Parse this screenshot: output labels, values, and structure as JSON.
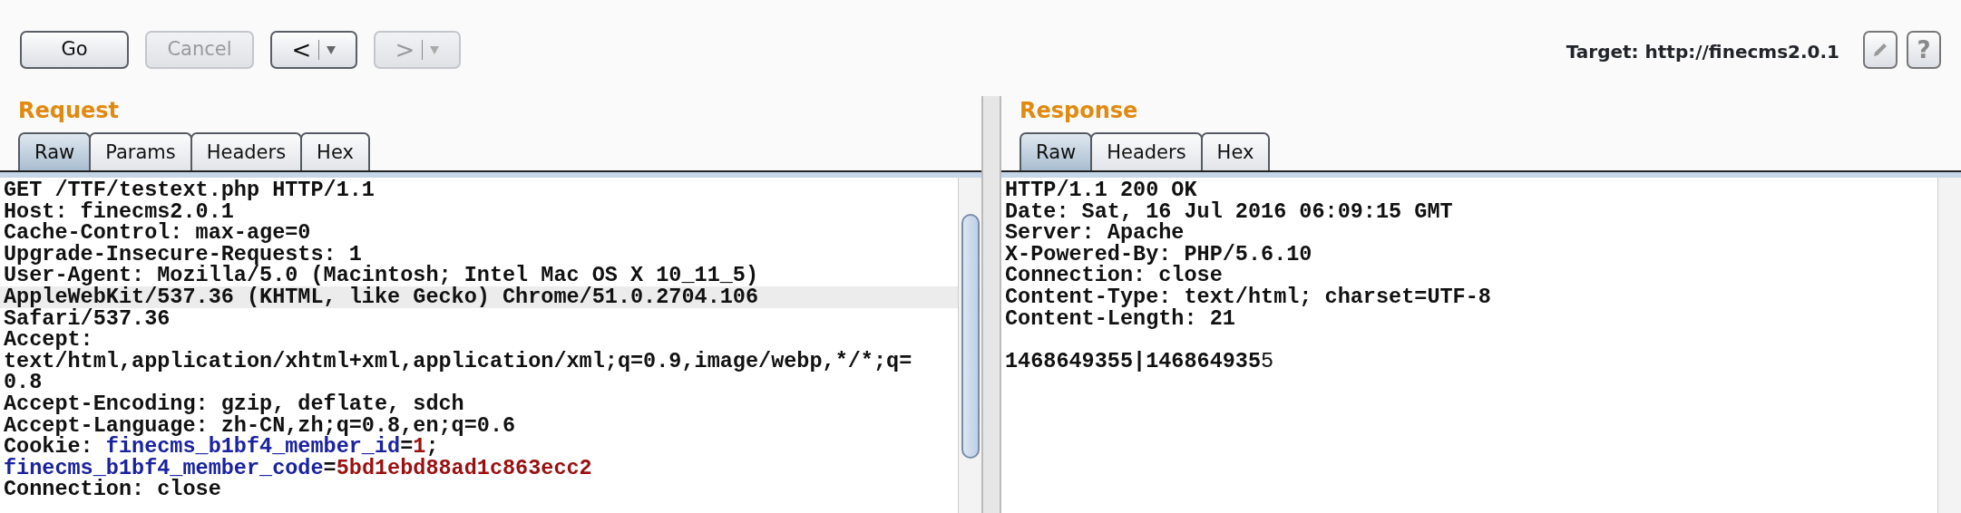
{
  "toolbar": {
    "buttons": [
      {
        "kind": "text",
        "label": "Go",
        "disabled": false
      },
      {
        "kind": "text",
        "label": "Cancel",
        "disabled": true
      },
      {
        "kind": "history",
        "label": "<",
        "disabled": false
      },
      {
        "kind": "history",
        "label": ">",
        "disabled": true
      }
    ],
    "target": "Target: http://finecms2.0.1",
    "help_label": "?"
  },
  "request": {
    "title": "Request",
    "tabs": [
      {
        "label": "Raw",
        "selected": true
      },
      {
        "label": "Params",
        "selected": false
      },
      {
        "label": "Headers",
        "selected": false
      },
      {
        "label": "Hex",
        "selected": false
      }
    ],
    "lines": [
      {
        "highlighted": false,
        "segments": [
          {
            "kind": "plain",
            "text": "GET /TTF/testext.php HTTP/1.1"
          }
        ]
      },
      {
        "highlighted": false,
        "segments": [
          {
            "kind": "plain",
            "text": "Host: finecms2.0.1"
          }
        ]
      },
      {
        "highlighted": false,
        "segments": [
          {
            "kind": "plain",
            "text": "Cache-Control: max-age=0"
          }
        ]
      },
      {
        "highlighted": false,
        "segments": [
          {
            "kind": "plain",
            "text": "Upgrade-Insecure-Requests: 1"
          }
        ]
      },
      {
        "highlighted": false,
        "segments": [
          {
            "kind": "plain",
            "text": "User-Agent: Mozilla/5.0 (Macintosh; Intel Mac OS X 10_11_5)"
          }
        ]
      },
      {
        "highlighted": true,
        "segments": [
          {
            "kind": "plain",
            "text": "AppleWebKit/537.36 (KHTML, like Gecko) Chrome/51.0.2704.106"
          }
        ]
      },
      {
        "highlighted": false,
        "segments": [
          {
            "kind": "plain",
            "text": "Safari/537.36"
          }
        ]
      },
      {
        "highlighted": false,
        "segments": [
          {
            "kind": "plain",
            "text": "Accept:"
          }
        ]
      },
      {
        "highlighted": false,
        "segments": [
          {
            "kind": "plain",
            "text": "text/html,application/xhtml+xml,application/xml;q=0.9,image/webp,*/*;q="
          }
        ]
      },
      {
        "highlighted": false,
        "segments": [
          {
            "kind": "plain",
            "text": "0.8"
          }
        ]
      },
      {
        "highlighted": false,
        "segments": [
          {
            "kind": "plain",
            "text": "Accept-Encoding: gzip, deflate, sdch"
          }
        ]
      },
      {
        "highlighted": false,
        "segments": [
          {
            "kind": "plain",
            "text": "Accept-Language: zh-CN,zh;q=0.8,en;q=0.6"
          }
        ]
      },
      {
        "highlighted": false,
        "segments": [
          {
            "kind": "plain",
            "text": "Cookie: "
          },
          {
            "kind": "name",
            "text": "finecms_b1bf4_member_id"
          },
          {
            "kind": "plain",
            "text": "="
          },
          {
            "kind": "value",
            "text": "1"
          },
          {
            "kind": "plain",
            "text": ";"
          }
        ]
      },
      {
        "highlighted": false,
        "segments": [
          {
            "kind": "name",
            "text": "finecms_b1bf4_member_code"
          },
          {
            "kind": "plain",
            "text": "="
          },
          {
            "kind": "value",
            "text": "5bd1ebd88ad1c863ecc2"
          }
        ]
      },
      {
        "highlighted": false,
        "segments": [
          {
            "kind": "plain",
            "text": "Connection: close"
          }
        ]
      }
    ]
  },
  "response": {
    "title": "Response",
    "tabs": [
      {
        "label": "Raw",
        "selected": true
      },
      {
        "label": "Headers",
        "selected": false
      },
      {
        "label": "Hex",
        "selected": false
      }
    ],
    "lines": [
      {
        "highlighted": false,
        "segments": [
          {
            "kind": "plain",
            "text": "HTTP/1.1 200 OK"
          }
        ]
      },
      {
        "highlighted": false,
        "segments": [
          {
            "kind": "plain",
            "text": "Date: Sat, 16 Jul 2016 06:09:15 GMT"
          }
        ]
      },
      {
        "highlighted": false,
        "segments": [
          {
            "kind": "plain",
            "text": "Server: Apache"
          }
        ]
      },
      {
        "highlighted": false,
        "segments": [
          {
            "kind": "plain",
            "text": "X-Powered-By: PHP/5.6.10"
          }
        ]
      },
      {
        "highlighted": false,
        "segments": [
          {
            "kind": "plain",
            "text": "Connection: close"
          }
        ]
      },
      {
        "highlighted": false,
        "segments": [
          {
            "kind": "plain",
            "text": "Content-Type: text/html; charset=UTF-8"
          }
        ]
      },
      {
        "highlighted": false,
        "segments": [
          {
            "kind": "plain",
            "text": "Content-Length: 21"
          }
        ]
      },
      {
        "highlighted": false
      },
      {
        "highlighted": false,
        "segments": [
          {
            "kind": "body",
            "text": "**1468649355|146864935**5"
          }
        ]
      }
    ]
  }
}
